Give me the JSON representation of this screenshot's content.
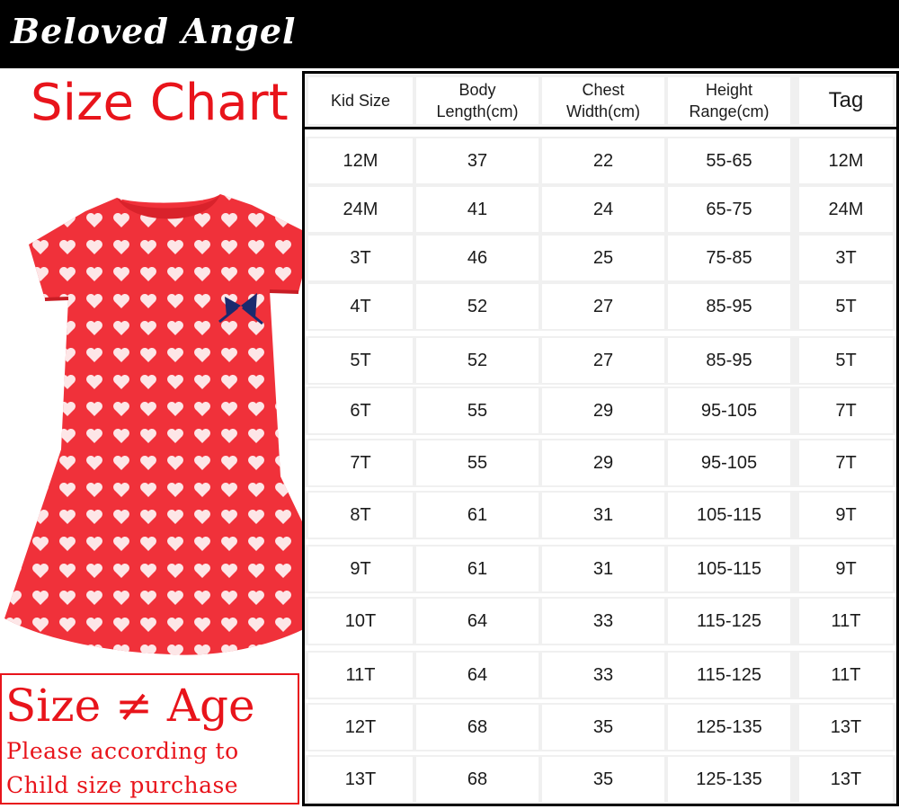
{
  "brand": "Beloved Angel",
  "title": "Size Chart",
  "note": {
    "headline": "Size ≠ Age",
    "line1": "Please according to",
    "line2": "Child size purchase"
  },
  "colors": {
    "accent": "#e8141b",
    "banner": "#000000",
    "dress": "#f0313a"
  },
  "table": {
    "headers": [
      "Kid Size",
      "Body\nLength(cm)",
      "Chest\nWidth(cm)",
      "Height\nRange(cm)",
      "Tag"
    ],
    "rows": [
      [
        "12M",
        "37",
        "22",
        "55-65",
        "12M"
      ],
      [
        "24M",
        "41",
        "24",
        "65-75",
        "24M"
      ],
      [
        "3T",
        "46",
        "25",
        "75-85",
        "3T"
      ],
      [
        "4T",
        "52",
        "27",
        "85-95",
        "5T"
      ],
      [
        "5T",
        "52",
        "27",
        "85-95",
        "5T"
      ],
      [
        "6T",
        "55",
        "29",
        "95-105",
        "7T"
      ],
      [
        "7T",
        "55",
        "29",
        "95-105",
        "7T"
      ],
      [
        "8T",
        "61",
        "31",
        "105-115",
        "9T"
      ],
      [
        "9T",
        "61",
        "31",
        "105-115",
        "9T"
      ],
      [
        "10T",
        "64",
        "33",
        "115-125",
        "11T"
      ],
      [
        "11T",
        "64",
        "33",
        "115-125",
        "11T"
      ],
      [
        "12T",
        "68",
        "35",
        "125-135",
        "13T"
      ],
      [
        "13T",
        "68",
        "35",
        "125-135",
        "13T"
      ]
    ]
  }
}
